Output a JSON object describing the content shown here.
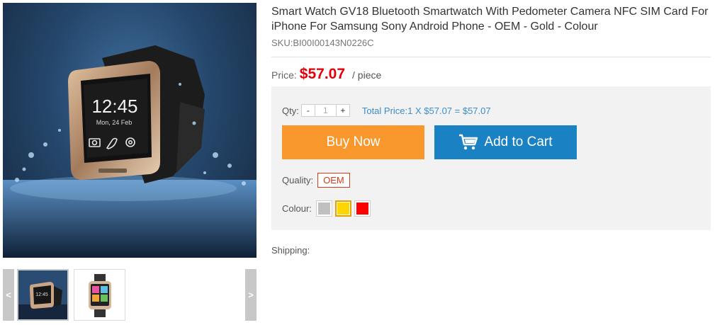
{
  "product": {
    "title": "Smart Watch GV18 Bluetooth Smartwatch With Pedometer Camera NFC SIM Card For iPhone For Samsung Sony Android Phone - OEM - Gold - Colour",
    "sku": "SKU:BI00I00143N0226C"
  },
  "gallery": {
    "watch_time": "12:45",
    "watch_date": "Mon, 24 Feb",
    "prev_arrow": "<",
    "next_arrow": ">",
    "thumbnail_count": 2,
    "active_thumbnail": 1
  },
  "price": {
    "label": "Price:",
    "value": "$57.07",
    "unit": "/ piece"
  },
  "quantity": {
    "label": "Qty:",
    "minus": "-",
    "value": "1",
    "plus": "+",
    "total": "Total Price:1 X $57.07 = $57.07"
  },
  "buttons": {
    "buy_now": "Buy Now",
    "add_to_cart": "Add to Cart"
  },
  "options": {
    "quality_label": "Quality:",
    "quality_value": "OEM",
    "colour_label": "Colour:",
    "colours": [
      "#c0c0c0",
      "#ffd700",
      "#ff0000"
    ],
    "selected_colour_index": 1
  },
  "shipping": {
    "label": "Shipping:"
  },
  "colors": {
    "price": "#e4000b",
    "buy_now": "#f7972c",
    "add_to_cart": "#1a82c3",
    "total_price": "#3b8ecb",
    "quality_border": "#d53b17"
  }
}
